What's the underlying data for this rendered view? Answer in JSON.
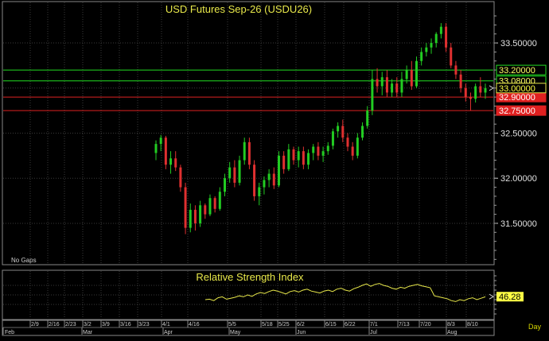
{
  "chart_data": [
    {
      "type": "candlestick",
      "title": "USD Futures Sep-26 (USDU26)",
      "note": "No Gaps",
      "ylim": [
        31.05,
        33.95
      ],
      "y_ticks": [
        31.5,
        32.0,
        32.5,
        33.5
      ],
      "y_tick_labels": [
        "31.50000",
        "32.00000",
        "32.50000",
        "33.50000"
      ],
      "horizontal_lines": [
        {
          "value": 33.2,
          "label": "33.20000",
          "color": "#22dd22"
        },
        {
          "value": 33.08,
          "label": "33.08000",
          "color": "#22dd22"
        },
        {
          "value": 32.9,
          "label": "32.90000",
          "color": "#dd2222"
        },
        {
          "value": 32.75,
          "label": "32.75000",
          "color": "#dd2222"
        }
      ],
      "last_value": {
        "value": 33.0,
        "label": "33.00000"
      },
      "grid": true,
      "colors": {
        "up": "#22cc22",
        "down": "#e03030"
      },
      "candles": [
        [
          32.28,
          32.42,
          32.2,
          32.38
        ],
        [
          32.38,
          32.48,
          32.3,
          32.45
        ],
        [
          32.45,
          32.47,
          32.1,
          32.15
        ],
        [
          32.15,
          32.3,
          32.05,
          32.22
        ],
        [
          32.22,
          32.3,
          32.08,
          32.12
        ],
        [
          32.12,
          32.15,
          31.85,
          31.9
        ],
        [
          31.9,
          31.95,
          31.38,
          31.45
        ],
        [
          31.45,
          31.72,
          31.4,
          31.65
        ],
        [
          31.65,
          31.7,
          31.42,
          31.5
        ],
        [
          31.5,
          31.75,
          31.46,
          31.7
        ],
        [
          31.7,
          31.72,
          31.55,
          31.6
        ],
        [
          31.6,
          31.82,
          31.58,
          31.78
        ],
        [
          31.78,
          31.8,
          31.62,
          31.66
        ],
        [
          31.66,
          31.9,
          31.64,
          31.85
        ],
        [
          31.85,
          32.05,
          31.8,
          32.0
        ],
        [
          32.0,
          32.18,
          31.95,
          32.12
        ],
        [
          32.12,
          32.2,
          31.9,
          31.95
        ],
        [
          31.95,
          32.25,
          31.92,
          32.2
        ],
        [
          32.2,
          32.45,
          32.15,
          32.4
        ],
        [
          32.4,
          32.45,
          32.1,
          32.15
        ],
        [
          32.15,
          32.2,
          31.75,
          31.8
        ],
        [
          31.8,
          31.95,
          31.7,
          31.9
        ],
        [
          31.9,
          32.02,
          31.82,
          31.98
        ],
        [
          31.98,
          32.1,
          31.9,
          32.05
        ],
        [
          32.05,
          32.12,
          31.88,
          31.92
        ],
        [
          31.92,
          32.3,
          31.9,
          32.25
        ],
        [
          32.25,
          32.3,
          32.05,
          32.1
        ],
        [
          32.1,
          32.38,
          32.08,
          32.32
        ],
        [
          32.32,
          32.35,
          32.15,
          32.2
        ],
        [
          32.2,
          32.35,
          32.12,
          32.3
        ],
        [
          32.3,
          32.35,
          32.1,
          32.15
        ],
        [
          32.15,
          32.32,
          32.1,
          32.28
        ],
        [
          32.28,
          32.38,
          32.2,
          32.35
        ],
        [
          32.35,
          32.4,
          32.2,
          32.25
        ],
        [
          32.25,
          32.35,
          32.18,
          32.3
        ],
        [
          32.3,
          32.4,
          32.26,
          32.36
        ],
        [
          32.36,
          32.55,
          32.32,
          32.52
        ],
        [
          32.52,
          32.62,
          32.45,
          32.58
        ],
        [
          32.58,
          32.65,
          32.4,
          32.45
        ],
        [
          32.45,
          32.5,
          32.3,
          32.35
        ],
        [
          32.35,
          32.4,
          32.2,
          32.25
        ],
        [
          32.25,
          32.5,
          32.22,
          32.45
        ],
        [
          32.45,
          32.62,
          32.42,
          32.58
        ],
        [
          32.58,
          32.8,
          32.55,
          32.75
        ],
        [
          32.75,
          33.2,
          32.7,
          33.1
        ],
        [
          33.1,
          33.22,
          32.95,
          33.02
        ],
        [
          33.02,
          33.18,
          32.92,
          33.12
        ],
        [
          33.12,
          33.2,
          32.9,
          32.95
        ],
        [
          32.95,
          33.1,
          32.9,
          33.05
        ],
        [
          33.05,
          33.12,
          32.9,
          32.95
        ],
        [
          32.95,
          33.18,
          32.9,
          33.1
        ],
        [
          33.1,
          33.25,
          33.05,
          33.2
        ],
        [
          33.2,
          33.3,
          32.98,
          33.02
        ],
        [
          33.02,
          33.35,
          33.0,
          33.3
        ],
        [
          33.3,
          33.45,
          33.25,
          33.4
        ],
        [
          33.4,
          33.5,
          33.35,
          33.45
        ],
        [
          33.45,
          33.55,
          33.38,
          33.5
        ],
        [
          33.5,
          33.62,
          33.45,
          33.6
        ],
        [
          33.6,
          33.72,
          33.55,
          33.68
        ],
        [
          33.68,
          33.72,
          33.4,
          33.45
        ],
        [
          33.45,
          33.5,
          33.22,
          33.25
        ],
        [
          33.25,
          33.3,
          33.1,
          33.15
        ],
        [
          33.15,
          33.2,
          32.95,
          33.0
        ],
        [
          33.0,
          33.05,
          32.85,
          32.9
        ],
        [
          32.9,
          32.95,
          32.75,
          32.88
        ],
        [
          32.88,
          33.05,
          32.84,
          33.02
        ],
        [
          33.02,
          33.12,
          32.9,
          32.95
        ],
        [
          32.95,
          33.05,
          32.88,
          33.0
        ]
      ]
    },
    {
      "type": "line",
      "title": "Relative Strength Index",
      "last_value": {
        "value": 46.28,
        "label": "46.28"
      },
      "ylim": [
        0,
        100
      ],
      "color": "#e8e84a",
      "values": [
        40,
        41,
        38,
        44,
        46,
        41,
        43,
        45,
        48,
        46,
        50,
        47,
        52,
        55,
        53,
        57,
        60,
        58,
        55,
        52,
        57,
        59,
        56,
        60,
        62,
        58,
        56,
        54,
        58,
        60,
        57,
        62,
        64,
        60,
        58,
        63,
        66,
        70,
        73,
        68,
        72,
        74,
        70,
        68,
        64,
        62,
        66,
        64,
        68,
        70,
        72,
        69,
        67,
        65,
        48,
        46,
        44,
        42,
        38,
        36,
        40,
        38,
        42,
        44,
        40,
        43,
        46
      ]
    }
  ],
  "x_axis": {
    "labels": [
      "2/9",
      "2/16",
      "2/23",
      "3/2",
      "3/9",
      "3/16",
      "3/23",
      "4/1",
      "4/16",
      "5/5",
      "5/18",
      "5/25",
      "6/2",
      "6/15",
      "6/22",
      "7/1",
      "7/13",
      "7/20",
      "8/3",
      "8/10"
    ],
    "months": [
      "Feb",
      "Mar",
      "Apr",
      "May",
      "Jun",
      "Jul",
      "Aug"
    ],
    "period": "Day"
  }
}
